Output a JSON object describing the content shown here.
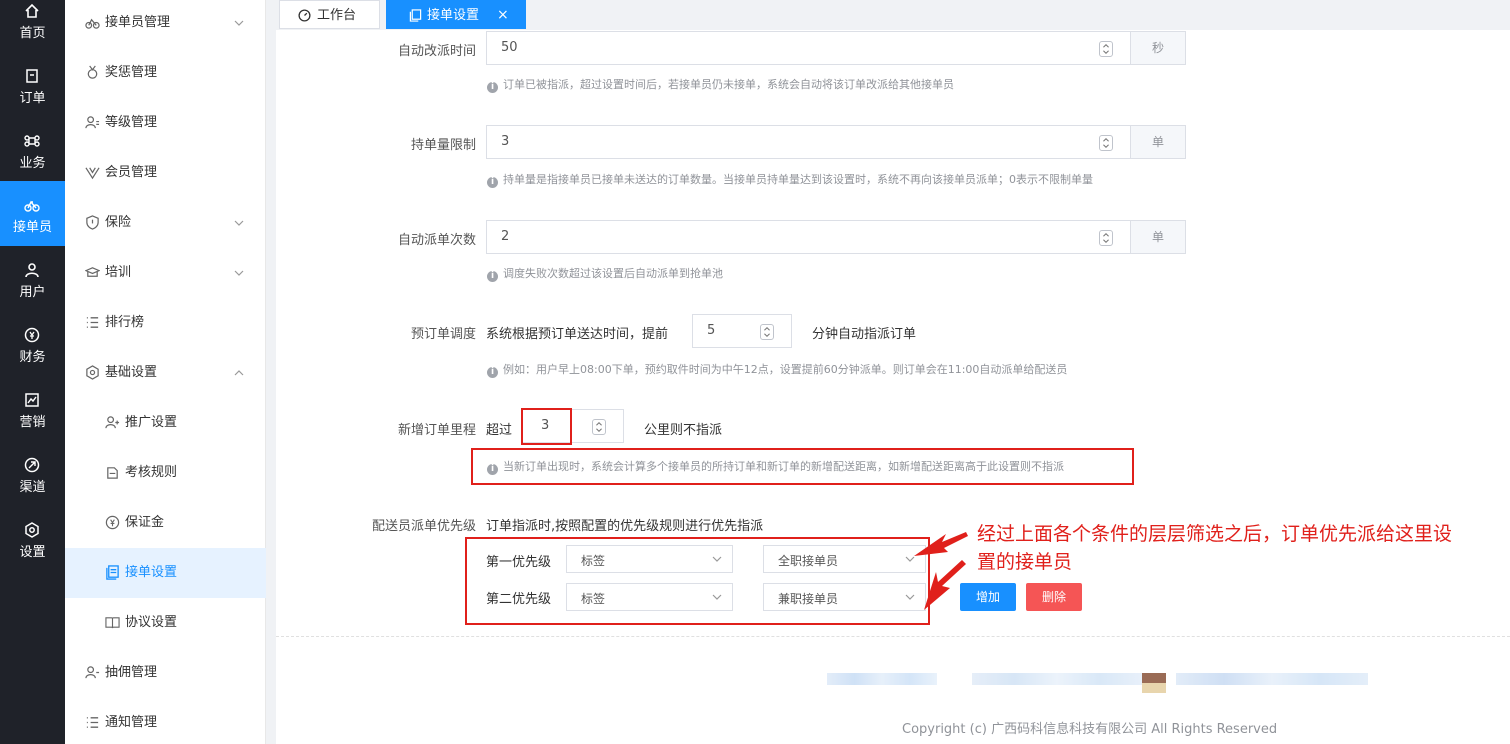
{
  "nav": [
    {
      "label": "首页",
      "icon": "home-icon"
    },
    {
      "label": "订单",
      "icon": "order-icon"
    },
    {
      "label": "业务",
      "icon": "command-icon"
    },
    {
      "label": "接单员",
      "icon": "bike-icon"
    },
    {
      "label": "用户",
      "icon": "user-icon"
    },
    {
      "label": "财务",
      "icon": "money-icon"
    },
    {
      "label": "营销",
      "icon": "chart-icon"
    },
    {
      "label": "渠道",
      "icon": "link-icon"
    },
    {
      "label": "设置",
      "icon": "gear-icon"
    }
  ],
  "submenu": [
    {
      "label": "接单员管理",
      "icon": "bike-icon"
    },
    {
      "label": "奖惩管理",
      "icon": "medal-icon"
    },
    {
      "label": "等级管理",
      "icon": "user-level-icon"
    },
    {
      "label": "会员管理",
      "icon": "vip-icon"
    },
    {
      "label": "保险",
      "icon": "shield-icon"
    },
    {
      "label": "培训",
      "icon": "training-icon"
    },
    {
      "label": "排行榜",
      "icon": "list-icon"
    },
    {
      "label": "基础设置",
      "icon": "hexagon-gear-icon"
    },
    {
      "label": "推广设置",
      "icon": "user-promo-icon"
    },
    {
      "label": "考核规则",
      "icon": "rule-icon"
    },
    {
      "label": "保证金",
      "icon": "deposit-icon"
    },
    {
      "label": "接单设置",
      "icon": "doc-icon"
    },
    {
      "label": "协议设置",
      "icon": "book-icon"
    },
    {
      "label": "抽佣管理",
      "icon": "user-commission-icon"
    },
    {
      "label": "通知管理",
      "icon": "notice-list-icon"
    }
  ],
  "tabs": [
    {
      "label": "工作台"
    },
    {
      "label": "接单设置",
      "close": "×"
    }
  ],
  "form": {
    "reassign": {
      "label": "自动改派时间",
      "value": "50",
      "unit": "秒",
      "hint": "订单已被指派，超过设置时间后，若接单员仍未接单，系统会自动将该订单改派给其他接单员"
    },
    "hold_limit": {
      "label": "持单量限制",
      "value": "3",
      "unit": "单",
      "hint": "持单量是指接单员已接单未送达的订单数量。当接单员持单量达到该设置时，系统不再向该接单员派单；0表示不限制单量"
    },
    "auto_dispatch": {
      "label": "自动派单次数",
      "value": "2",
      "unit": "单",
      "hint": "调度失败次数超过该设置后自动派单到抢单池"
    },
    "preorder": {
      "label": "预订单调度",
      "prefix": "系统根据预订单送达时间，提前",
      "value": "5",
      "suffix": "分钟自动指派订单",
      "hint": "例如：用户早上08:00下单，预约取件时间为中午12点，设置提前60分钟派单。则订单会在11:00自动派单给配送员"
    },
    "distance": {
      "label": "新增订单里程",
      "prefix": "超过",
      "value": "3",
      "suffix": "公里则不指派",
      "hint": "当新订单出现时，系统会计算多个接单员的所持订单和新订单的新增配送距离，如新增配送距离高于此设置则不指派"
    },
    "priority": {
      "label": "配送员派单优先级",
      "desc": "订单指派时,按照配置的优先级规则进行优先指派",
      "rows": [
        {
          "label": "第一优先级",
          "type": "标签",
          "value": "全职接单员"
        },
        {
          "label": "第二优先级",
          "type": "标签",
          "value": "兼职接单员"
        }
      ],
      "add_label": "增加",
      "delete_label": "删除"
    },
    "hint_icon": "info-icon"
  },
  "annotation": {
    "line1": "经过上面各个条件的层层筛选之后，订单优先派给这里设",
    "line2": "置的接单员"
  },
  "footer": {
    "copyright": "Copyright (c) 广西码科信息科技有限公司 All Rights Reserved"
  },
  "colors": {
    "primary": "#1890ff",
    "danger": "#f55555",
    "annotation": "#e0201b",
    "nav_bg": "#1f2229"
  }
}
